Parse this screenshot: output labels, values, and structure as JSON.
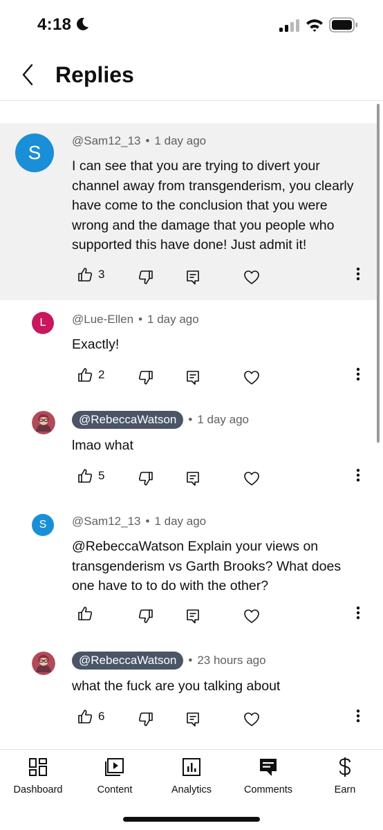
{
  "status_bar": {
    "time": "4:18",
    "icons": [
      "moon-icon",
      "cellular-signal-icon",
      "wifi-icon",
      "battery-icon"
    ]
  },
  "header": {
    "title": "Replies",
    "back_icon": "chevron-left-icon"
  },
  "comments": [
    {
      "author": "@Sam12_13",
      "author_style": "plain",
      "avatar_letter": "S",
      "avatar_color": "#1a8fd8",
      "time": "1 day ago",
      "text": "I can see that you are trying to divert your channel away from transgenderism, you clearly have come to the conclusion that you were wrong and the damage that you people who supported this have done! Just admit it!",
      "likes": "3",
      "highlighted": true
    },
    {
      "author": "@Lue-Ellen",
      "author_style": "plain",
      "avatar_letter": "L",
      "avatar_color": "#c8175d",
      "time": "1 day ago",
      "text": "Exactly!",
      "likes": "2",
      "highlighted": false
    },
    {
      "author": "@RebeccaWatson",
      "author_style": "creator-chip",
      "avatar_letter": "",
      "avatar_color": "#b24a5a",
      "time": "1 day ago",
      "text": "lmao what",
      "likes": "5",
      "highlighted": false
    },
    {
      "author": "@Sam12_13",
      "author_style": "plain",
      "avatar_letter": "S",
      "avatar_color": "#1a8fd8",
      "time": "1 day ago",
      "text": "@RebeccaWatson Explain your views on transgenderism vs Garth Brooks? What does one have to to do with the other?",
      "likes": "",
      "highlighted": false
    },
    {
      "author": "@RebeccaWatson",
      "author_style": "creator-chip",
      "avatar_letter": "",
      "avatar_color": "#b24a5a",
      "time": "23 hours ago",
      "text": "what the fuck are you talking about",
      "likes": "6",
      "highlighted": false
    }
  ],
  "action_icons": [
    "thumbs-up-icon",
    "thumbs-down-icon",
    "reply-icon",
    "heart-icon",
    "more-vertical-icon"
  ],
  "bottom_nav": {
    "items": [
      {
        "label": "Dashboard",
        "icon": "dashboard-icon",
        "active": false
      },
      {
        "label": "Content",
        "icon": "content-icon",
        "active": false
      },
      {
        "label": "Analytics",
        "icon": "analytics-icon",
        "active": false
      },
      {
        "label": "Comments",
        "icon": "comments-icon",
        "active": true
      },
      {
        "label": "Earn",
        "icon": "dollar-icon",
        "active": false
      }
    ]
  },
  "colors": {
    "highlight_background": "#f1f1f1",
    "creator_chip": "#4a5566",
    "secondary_text": "#606060"
  }
}
